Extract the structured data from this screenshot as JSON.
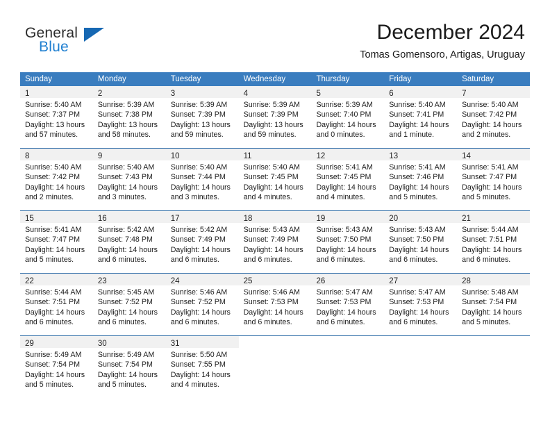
{
  "brand": {
    "name_part1": "General",
    "name_part2": "Blue",
    "logo_icon": "triangle-logo-icon",
    "accent_color": "#1668b3"
  },
  "header": {
    "title": "December 2024",
    "subtitle": "Tomas Gomensoro, Artigas, Uruguay"
  },
  "theme": {
    "header_row_bg": "#3a7dbf",
    "header_row_text": "#ffffff",
    "daynum_band_bg": "#f1f1f1",
    "row_divider": "#2f6da8",
    "body_text": "#1c1c1c"
  },
  "weekdays": [
    "Sunday",
    "Monday",
    "Tuesday",
    "Wednesday",
    "Thursday",
    "Friday",
    "Saturday"
  ],
  "weeks": [
    [
      {
        "day": "1",
        "sunrise": "Sunrise: 5:40 AM",
        "sunset": "Sunset: 7:37 PM",
        "daylight1": "Daylight: 13 hours",
        "daylight2": "and 57 minutes."
      },
      {
        "day": "2",
        "sunrise": "Sunrise: 5:39 AM",
        "sunset": "Sunset: 7:38 PM",
        "daylight1": "Daylight: 13 hours",
        "daylight2": "and 58 minutes."
      },
      {
        "day": "3",
        "sunrise": "Sunrise: 5:39 AM",
        "sunset": "Sunset: 7:39 PM",
        "daylight1": "Daylight: 13 hours",
        "daylight2": "and 59 minutes."
      },
      {
        "day": "4",
        "sunrise": "Sunrise: 5:39 AM",
        "sunset": "Sunset: 7:39 PM",
        "daylight1": "Daylight: 13 hours",
        "daylight2": "and 59 minutes."
      },
      {
        "day": "5",
        "sunrise": "Sunrise: 5:39 AM",
        "sunset": "Sunset: 7:40 PM",
        "daylight1": "Daylight: 14 hours",
        "daylight2": "and 0 minutes."
      },
      {
        "day": "6",
        "sunrise": "Sunrise: 5:40 AM",
        "sunset": "Sunset: 7:41 PM",
        "daylight1": "Daylight: 14 hours",
        "daylight2": "and 1 minute."
      },
      {
        "day": "7",
        "sunrise": "Sunrise: 5:40 AM",
        "sunset": "Sunset: 7:42 PM",
        "daylight1": "Daylight: 14 hours",
        "daylight2": "and 2 minutes."
      }
    ],
    [
      {
        "day": "8",
        "sunrise": "Sunrise: 5:40 AM",
        "sunset": "Sunset: 7:42 PM",
        "daylight1": "Daylight: 14 hours",
        "daylight2": "and 2 minutes."
      },
      {
        "day": "9",
        "sunrise": "Sunrise: 5:40 AM",
        "sunset": "Sunset: 7:43 PM",
        "daylight1": "Daylight: 14 hours",
        "daylight2": "and 3 minutes."
      },
      {
        "day": "10",
        "sunrise": "Sunrise: 5:40 AM",
        "sunset": "Sunset: 7:44 PM",
        "daylight1": "Daylight: 14 hours",
        "daylight2": "and 3 minutes."
      },
      {
        "day": "11",
        "sunrise": "Sunrise: 5:40 AM",
        "sunset": "Sunset: 7:45 PM",
        "daylight1": "Daylight: 14 hours",
        "daylight2": "and 4 minutes."
      },
      {
        "day": "12",
        "sunrise": "Sunrise: 5:41 AM",
        "sunset": "Sunset: 7:45 PM",
        "daylight1": "Daylight: 14 hours",
        "daylight2": "and 4 minutes."
      },
      {
        "day": "13",
        "sunrise": "Sunrise: 5:41 AM",
        "sunset": "Sunset: 7:46 PM",
        "daylight1": "Daylight: 14 hours",
        "daylight2": "and 5 minutes."
      },
      {
        "day": "14",
        "sunrise": "Sunrise: 5:41 AM",
        "sunset": "Sunset: 7:47 PM",
        "daylight1": "Daylight: 14 hours",
        "daylight2": "and 5 minutes."
      }
    ],
    [
      {
        "day": "15",
        "sunrise": "Sunrise: 5:41 AM",
        "sunset": "Sunset: 7:47 PM",
        "daylight1": "Daylight: 14 hours",
        "daylight2": "and 5 minutes."
      },
      {
        "day": "16",
        "sunrise": "Sunrise: 5:42 AM",
        "sunset": "Sunset: 7:48 PM",
        "daylight1": "Daylight: 14 hours",
        "daylight2": "and 6 minutes."
      },
      {
        "day": "17",
        "sunrise": "Sunrise: 5:42 AM",
        "sunset": "Sunset: 7:49 PM",
        "daylight1": "Daylight: 14 hours",
        "daylight2": "and 6 minutes."
      },
      {
        "day": "18",
        "sunrise": "Sunrise: 5:43 AM",
        "sunset": "Sunset: 7:49 PM",
        "daylight1": "Daylight: 14 hours",
        "daylight2": "and 6 minutes."
      },
      {
        "day": "19",
        "sunrise": "Sunrise: 5:43 AM",
        "sunset": "Sunset: 7:50 PM",
        "daylight1": "Daylight: 14 hours",
        "daylight2": "and 6 minutes."
      },
      {
        "day": "20",
        "sunrise": "Sunrise: 5:43 AM",
        "sunset": "Sunset: 7:50 PM",
        "daylight1": "Daylight: 14 hours",
        "daylight2": "and 6 minutes."
      },
      {
        "day": "21",
        "sunrise": "Sunrise: 5:44 AM",
        "sunset": "Sunset: 7:51 PM",
        "daylight1": "Daylight: 14 hours",
        "daylight2": "and 6 minutes."
      }
    ],
    [
      {
        "day": "22",
        "sunrise": "Sunrise: 5:44 AM",
        "sunset": "Sunset: 7:51 PM",
        "daylight1": "Daylight: 14 hours",
        "daylight2": "and 6 minutes."
      },
      {
        "day": "23",
        "sunrise": "Sunrise: 5:45 AM",
        "sunset": "Sunset: 7:52 PM",
        "daylight1": "Daylight: 14 hours",
        "daylight2": "and 6 minutes."
      },
      {
        "day": "24",
        "sunrise": "Sunrise: 5:46 AM",
        "sunset": "Sunset: 7:52 PM",
        "daylight1": "Daylight: 14 hours",
        "daylight2": "and 6 minutes."
      },
      {
        "day": "25",
        "sunrise": "Sunrise: 5:46 AM",
        "sunset": "Sunset: 7:53 PM",
        "daylight1": "Daylight: 14 hours",
        "daylight2": "and 6 minutes."
      },
      {
        "day": "26",
        "sunrise": "Sunrise: 5:47 AM",
        "sunset": "Sunset: 7:53 PM",
        "daylight1": "Daylight: 14 hours",
        "daylight2": "and 6 minutes."
      },
      {
        "day": "27",
        "sunrise": "Sunrise: 5:47 AM",
        "sunset": "Sunset: 7:53 PM",
        "daylight1": "Daylight: 14 hours",
        "daylight2": "and 6 minutes."
      },
      {
        "day": "28",
        "sunrise": "Sunrise: 5:48 AM",
        "sunset": "Sunset: 7:54 PM",
        "daylight1": "Daylight: 14 hours",
        "daylight2": "and 5 minutes."
      }
    ],
    [
      {
        "day": "29",
        "sunrise": "Sunrise: 5:49 AM",
        "sunset": "Sunset: 7:54 PM",
        "daylight1": "Daylight: 14 hours",
        "daylight2": "and 5 minutes."
      },
      {
        "day": "30",
        "sunrise": "Sunrise: 5:49 AM",
        "sunset": "Sunset: 7:54 PM",
        "daylight1": "Daylight: 14 hours",
        "daylight2": "and 5 minutes."
      },
      {
        "day": "31",
        "sunrise": "Sunrise: 5:50 AM",
        "sunset": "Sunset: 7:55 PM",
        "daylight1": "Daylight: 14 hours",
        "daylight2": "and 4 minutes."
      },
      {
        "day": "",
        "sunrise": "",
        "sunset": "",
        "daylight1": "",
        "daylight2": ""
      },
      {
        "day": "",
        "sunrise": "",
        "sunset": "",
        "daylight1": "",
        "daylight2": ""
      },
      {
        "day": "",
        "sunrise": "",
        "sunset": "",
        "daylight1": "",
        "daylight2": ""
      },
      {
        "day": "",
        "sunrise": "",
        "sunset": "",
        "daylight1": "",
        "daylight2": ""
      }
    ]
  ]
}
